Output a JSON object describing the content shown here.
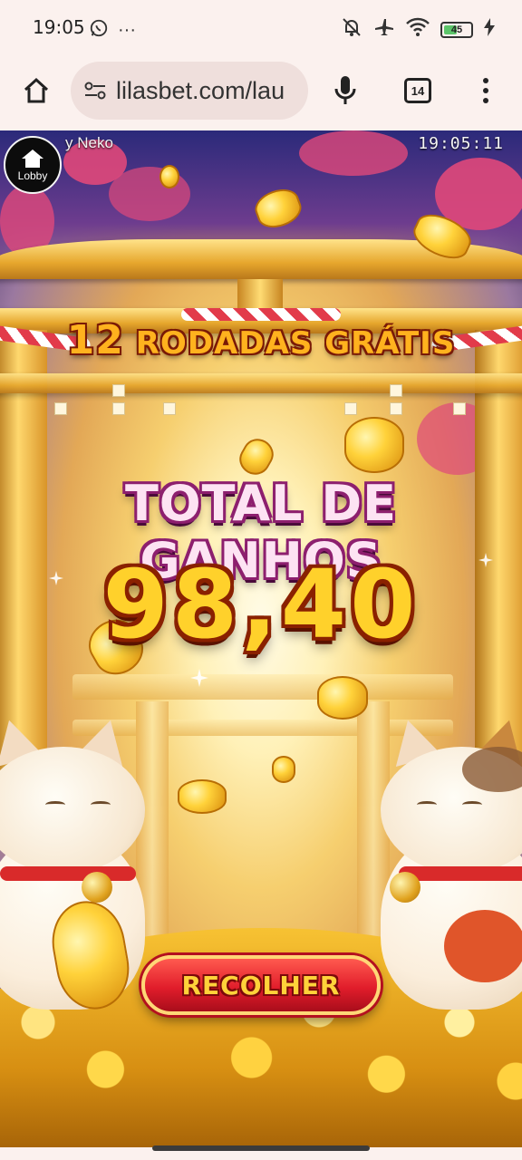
{
  "status_bar": {
    "time": "19:05",
    "more": "···",
    "battery_level": "45",
    "icons": [
      "whatsapp-icon",
      "mute-bell-icon",
      "airplane-icon",
      "wifi-icon",
      "battery-icon",
      "charging-icon"
    ]
  },
  "browser": {
    "url": "lilasbet.com/lau",
    "tab_count": "14"
  },
  "game": {
    "lobby_label": "Lobby",
    "title": "y Neko",
    "clock": "19:05:11",
    "free_spins_count": "12",
    "free_spins_text": "RODADAS GRÁTIS",
    "total_label": "TOTAL DE GANHOS",
    "total_value": "98,40",
    "collect_button": "RECOLHER"
  },
  "colors": {
    "accent_gold": "#ffd12b",
    "button_red": "#e11d2b",
    "label_pink": "#fde3f3"
  }
}
